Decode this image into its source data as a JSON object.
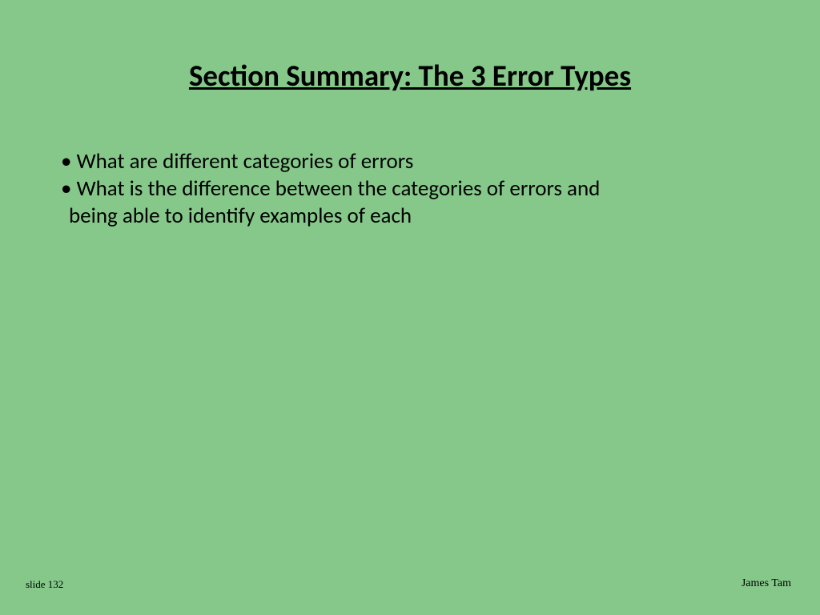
{
  "title": "Section Summary: The 3 Error Types",
  "bullets": [
    "What are different categories of errors",
    "What is the difference between the categories of errors and"
  ],
  "continuation": "being able to identify examples of each",
  "footer": {
    "slideNumber": "slide 132",
    "author": "James Tam"
  }
}
